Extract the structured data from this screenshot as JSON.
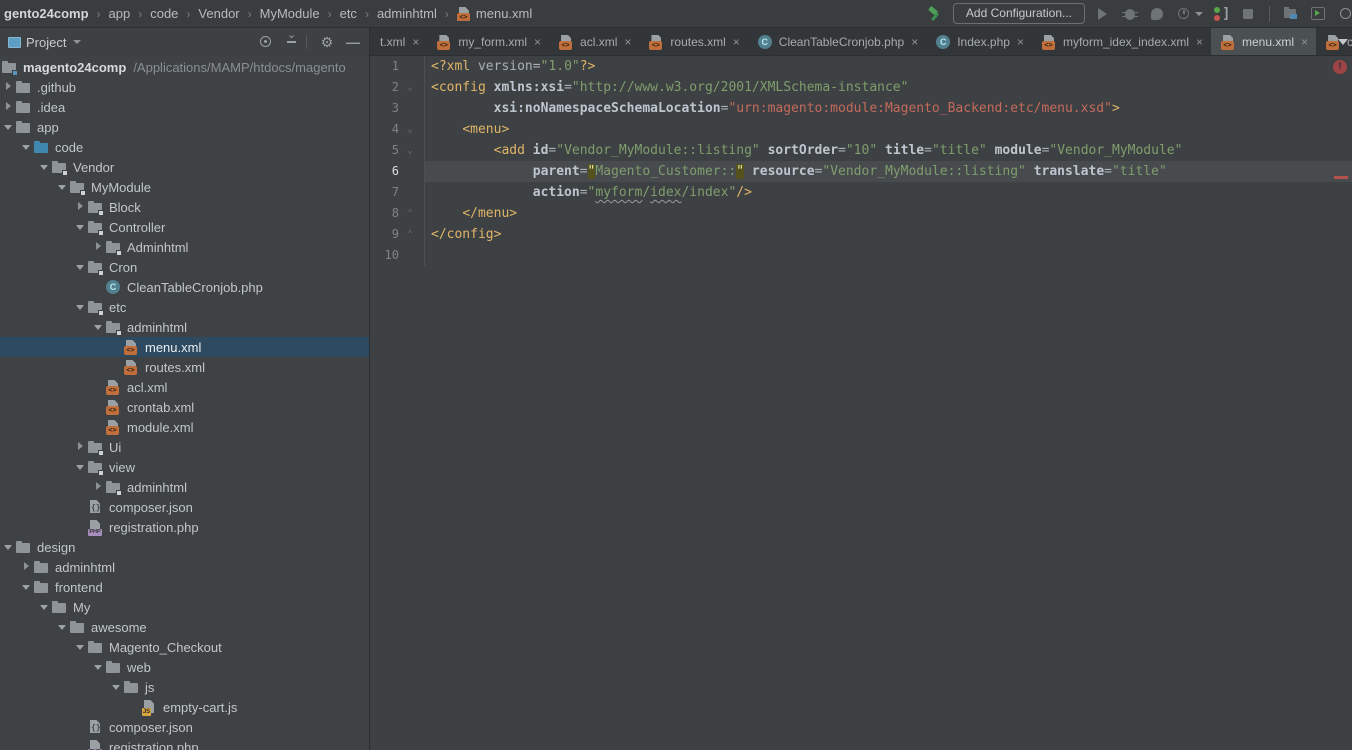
{
  "breadcrumb_bar": {
    "items": [
      {
        "label": "gento24comp",
        "bold": true
      },
      {
        "label": "app"
      },
      {
        "label": "code"
      },
      {
        "label": "Vendor"
      },
      {
        "label": "MyModule"
      },
      {
        "label": "etc"
      },
      {
        "label": "adminhtml"
      },
      {
        "label": "menu.xml",
        "icon": "xml"
      }
    ]
  },
  "run_toolbar": {
    "add_configuration_label": "Add Configuration...",
    "icons": [
      "hammer-icon",
      "run-icon",
      "debug-icon",
      "profile-icon",
      "run-with-coverage-icon",
      "attach-debugger-icon",
      "stop-icon",
      "tool-windows-icon",
      "run-window-icon",
      "search-icon"
    ]
  },
  "project_panel": {
    "title": "Project",
    "header_icons": [
      "locate-icon",
      "collapse-all-icon",
      "settings-icon",
      "hide-icon"
    ],
    "root": {
      "name": "magento24comp",
      "path": "/Applications/MAMP/htdocs/magento"
    },
    "tree": [
      {
        "depth": 1,
        "arrow": "right",
        "icon": "folder",
        "label": ".github"
      },
      {
        "depth": 1,
        "arrow": "right",
        "icon": "folder",
        "label": ".idea"
      },
      {
        "depth": 1,
        "arrow": "down",
        "icon": "folder",
        "label": "app"
      },
      {
        "depth": 2,
        "arrow": "down",
        "icon": "srcfolder",
        "label": "code"
      },
      {
        "depth": 3,
        "arrow": "down",
        "icon": "modfolder",
        "label": "Vendor"
      },
      {
        "depth": 4,
        "arrow": "down",
        "icon": "modfolder",
        "label": "MyModule"
      },
      {
        "depth": 5,
        "arrow": "right",
        "icon": "modfolder",
        "label": "Block"
      },
      {
        "depth": 5,
        "arrow": "down",
        "icon": "modfolder",
        "label": "Controller"
      },
      {
        "depth": 6,
        "arrow": "right",
        "icon": "modfolder",
        "label": "Adminhtml"
      },
      {
        "depth": 5,
        "arrow": "down",
        "icon": "modfolder",
        "label": "Cron"
      },
      {
        "depth": 6,
        "arrow": "none",
        "icon": "phpclass",
        "label": "CleanTableCronjob.php"
      },
      {
        "depth": 5,
        "arrow": "down",
        "icon": "modfolder",
        "label": "etc"
      },
      {
        "depth": 6,
        "arrow": "down",
        "icon": "modfolder",
        "label": "adminhtml"
      },
      {
        "depth": 7,
        "arrow": "none",
        "icon": "xml",
        "label": "menu.xml",
        "selected": true
      },
      {
        "depth": 7,
        "arrow": "none",
        "icon": "xml",
        "label": "routes.xml"
      },
      {
        "depth": 6,
        "arrow": "none",
        "icon": "xml",
        "label": "acl.xml"
      },
      {
        "depth": 6,
        "arrow": "none",
        "icon": "xml",
        "label": "crontab.xml"
      },
      {
        "depth": 6,
        "arrow": "none",
        "icon": "xml",
        "label": "module.xml"
      },
      {
        "depth": 5,
        "arrow": "right",
        "icon": "modfolder",
        "label": "Ui"
      },
      {
        "depth": 5,
        "arrow": "down",
        "icon": "modfolder",
        "label": "view"
      },
      {
        "depth": 6,
        "arrow": "right",
        "icon": "modfolder",
        "label": "adminhtml"
      },
      {
        "depth": 5,
        "arrow": "none",
        "icon": "json",
        "label": "composer.json"
      },
      {
        "depth": 5,
        "arrow": "none",
        "icon": "php",
        "label": "registration.php"
      },
      {
        "depth": 1,
        "arrow": "down",
        "icon": "folder",
        "label": "design"
      },
      {
        "depth": 2,
        "arrow": "right",
        "icon": "folder",
        "label": "adminhtml"
      },
      {
        "depth": 2,
        "arrow": "down",
        "icon": "folder",
        "label": "frontend"
      },
      {
        "depth": 3,
        "arrow": "down",
        "icon": "folder",
        "label": "My"
      },
      {
        "depth": 4,
        "arrow": "down",
        "icon": "folder",
        "label": "awesome"
      },
      {
        "depth": 5,
        "arrow": "down",
        "icon": "folder",
        "label": "Magento_Checkout"
      },
      {
        "depth": 6,
        "arrow": "down",
        "icon": "folder",
        "label": "web"
      },
      {
        "depth": 7,
        "arrow": "down",
        "icon": "folder",
        "label": "js"
      },
      {
        "depth": 8,
        "arrow": "none",
        "icon": "js",
        "label": "empty-cart.js"
      },
      {
        "depth": 5,
        "arrow": "none",
        "icon": "json",
        "label": "composer.json"
      },
      {
        "depth": 5,
        "arrow": "none",
        "icon": "php",
        "label": "registration.php"
      }
    ]
  },
  "tabs": [
    {
      "label": "t.xml",
      "icon": "none"
    },
    {
      "label": "my_form.xml",
      "icon": "xml"
    },
    {
      "label": "acl.xml",
      "icon": "xml"
    },
    {
      "label": "routes.xml",
      "icon": "xml"
    },
    {
      "label": "CleanTableCronjob.php",
      "icon": "phpclass"
    },
    {
      "label": "Index.php",
      "icon": "phpclass"
    },
    {
      "label": "myform_idex_index.xml",
      "icon": "xml"
    },
    {
      "label": "menu.xml",
      "icon": "xml",
      "active": true
    },
    {
      "label": "c",
      "icon": "xml",
      "partial": true
    }
  ],
  "editor": {
    "error_badge": "!",
    "lines": [
      {
        "num": "1",
        "tokens": [
          [
            "tag",
            "<?xml "
          ],
          [
            "plain",
            "version"
          ],
          [
            "plain",
            "="
          ],
          [
            "val",
            "\"1.0\""
          ],
          [
            "tag",
            "?>"
          ]
        ]
      },
      {
        "num": "2",
        "fold": "down",
        "tokens": [
          [
            "tag",
            "<config "
          ],
          [
            "attr",
            "xmlns:xsi"
          ],
          [
            "plain",
            "="
          ],
          [
            "val",
            "\"http://www.w3.org/2001/XMLSchema-instance\""
          ]
        ]
      },
      {
        "num": "3",
        "tokens": [
          [
            "plain",
            "        "
          ],
          [
            "attr",
            "xsi:noNamespaceSchemaLocation"
          ],
          [
            "plain",
            "="
          ],
          [
            "err",
            "\"urn:magento:module:Magento_Backend:etc/menu.xsd\""
          ],
          [
            "tag",
            ">"
          ]
        ]
      },
      {
        "num": "4",
        "fold": "down",
        "tokens": [
          [
            "plain",
            "    "
          ],
          [
            "tag",
            "<menu>"
          ]
        ]
      },
      {
        "num": "5",
        "fold": "down",
        "tokens": [
          [
            "plain",
            "        "
          ],
          [
            "tag",
            "<add "
          ],
          [
            "attr",
            "id"
          ],
          [
            "plain",
            "="
          ],
          [
            "val",
            "\"Vendor_MyModule::listing\""
          ],
          [
            "plain",
            " "
          ],
          [
            "attr",
            "sortOrder"
          ],
          [
            "plain",
            "="
          ],
          [
            "val",
            "\"10\""
          ],
          [
            "plain",
            " "
          ],
          [
            "attr",
            "title"
          ],
          [
            "plain",
            "="
          ],
          [
            "val",
            "\"title\""
          ],
          [
            "plain",
            " "
          ],
          [
            "attr",
            "module"
          ],
          [
            "plain",
            "="
          ],
          [
            "val",
            "\"Vendor_MyModule\""
          ]
        ]
      },
      {
        "num": "6",
        "current": true,
        "tokens": [
          [
            "plain",
            "             "
          ],
          [
            "attr",
            "parent"
          ],
          [
            "plain",
            "="
          ],
          [
            "valm",
            "\""
          ],
          [
            "val",
            "Magento_Customer::"
          ],
          [
            "valm",
            "\""
          ],
          [
            "plain",
            " "
          ],
          [
            "attr",
            "resource"
          ],
          [
            "plain",
            "="
          ],
          [
            "val",
            "\"Vendor_MyModule::listing\""
          ],
          [
            "plain",
            " "
          ],
          [
            "attr",
            "translate"
          ],
          [
            "plain",
            "="
          ],
          [
            "val",
            "\"title\""
          ]
        ]
      },
      {
        "num": "7",
        "tokens": [
          [
            "plain",
            "             "
          ],
          [
            "attr",
            "action"
          ],
          [
            "plain",
            "="
          ],
          [
            "val",
            "\""
          ],
          [
            "typo",
            "myform"
          ],
          [
            "val",
            "/"
          ],
          [
            "typo",
            "idex"
          ],
          [
            "val",
            "/index\""
          ],
          [
            "tag",
            "/>"
          ]
        ]
      },
      {
        "num": "8",
        "fold": "up",
        "tokens": [
          [
            "plain",
            "    "
          ],
          [
            "tag",
            "</menu>"
          ]
        ]
      },
      {
        "num": "9",
        "fold": "up",
        "tokens": [
          [
            "tag",
            "</config>"
          ]
        ]
      },
      {
        "num": "10",
        "tokens": []
      }
    ]
  }
}
